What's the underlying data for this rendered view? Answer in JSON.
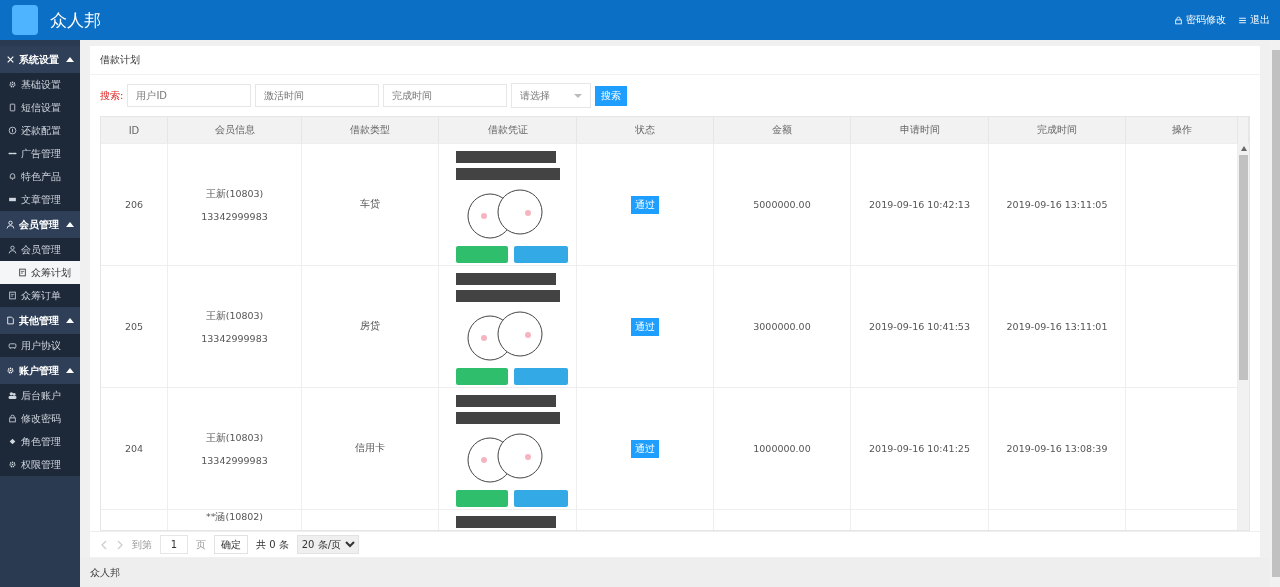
{
  "header": {
    "title": "众人邦",
    "links": [
      {
        "label": "密码修改"
      },
      {
        "label": "退出"
      }
    ]
  },
  "sidebar": {
    "groups": [
      {
        "label": "系统设置",
        "expanded": true,
        "items": [
          {
            "label": "基础设置",
            "selected": false
          },
          {
            "label": "短信设置",
            "selected": false
          },
          {
            "label": "还款配置",
            "selected": false
          },
          {
            "label": "广告管理",
            "selected": false
          },
          {
            "label": "特色产品",
            "selected": false
          },
          {
            "label": "文章管理",
            "selected": false
          }
        ]
      },
      {
        "label": "会员管理",
        "expanded": true,
        "items": [
          {
            "label": "会员管理",
            "selected": false
          },
          {
            "label": "众筹计划",
            "selected": true
          },
          {
            "label": "众筹订单",
            "selected": false
          }
        ]
      },
      {
        "label": "其他管理",
        "expanded": true,
        "items": [
          {
            "label": "用户协议",
            "selected": false
          }
        ]
      },
      {
        "label": "账户管理",
        "expanded": true,
        "items": [
          {
            "label": "后台账户",
            "selected": false
          },
          {
            "label": "修改密码",
            "selected": false
          },
          {
            "label": "角色管理",
            "selected": false
          },
          {
            "label": "权限管理",
            "selected": false
          }
        ]
      }
    ]
  },
  "panel": {
    "title": "借款计划",
    "search": {
      "label": "搜索:",
      "fields": [
        {
          "placeholder": "用户ID"
        },
        {
          "placeholder": "激活时间"
        },
        {
          "placeholder": "完成时间"
        }
      ],
      "select": {
        "placeholder": "请选择"
      },
      "button": "搜索"
    },
    "table": {
      "columns": [
        "ID",
        "会员信息",
        "借款类型",
        "借款凭证",
        "状态",
        "金额",
        "申请时间",
        "完成时间",
        "操作"
      ],
      "rows": [
        {
          "id": "206",
          "member_name": "王新(10803)",
          "member_phone": "13342999983",
          "loan_type": "车贷",
          "has_voucher": true,
          "status": "通过",
          "amount": "5000000.00",
          "applied": "2019-09-16 10:42:13",
          "completed": "2019-09-16 13:11:05"
        },
        {
          "id": "205",
          "member_name": "王新(10803)",
          "member_phone": "13342999983",
          "loan_type": "房贷",
          "has_voucher": true,
          "status": "通过",
          "amount": "3000000.00",
          "applied": "2019-09-16 10:41:53",
          "completed": "2019-09-16 13:11:01"
        },
        {
          "id": "204",
          "member_name": "王新(10803)",
          "member_phone": "13342999983",
          "loan_type": "信用卡",
          "has_voucher": true,
          "status": "通过",
          "amount": "1000000.00",
          "applied": "2019-09-16 10:41:25",
          "completed": "2019-09-16 13:08:39"
        },
        {
          "member_name": "**涵(10802)",
          "has_voucher": true
        }
      ]
    },
    "pagination": {
      "goto_label": "到第",
      "page": "1",
      "page_unit": "页",
      "confirm": "确定",
      "total": "共 0 条",
      "page_size": "20 条/页"
    }
  },
  "footer": {
    "text": "众人邦"
  }
}
